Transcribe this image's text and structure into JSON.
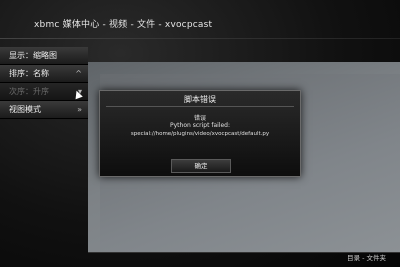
{
  "window": {
    "title": "xbmc 媒体中心 - 视频 - 文件 - xvocpcast"
  },
  "sidebar": {
    "items": [
      {
        "label": "显示：缩略图",
        "arrow": ""
      },
      {
        "label": "排序：名称",
        "arrow": "^"
      },
      {
        "label": "次序：升序",
        "arrow": "▾"
      },
      {
        "label": "视图模式",
        "arrow": "»"
      }
    ]
  },
  "dialog": {
    "title": "脚本错误",
    "subtitle": "错误",
    "message": "Python script failed:",
    "path": "special://home/plugins/video/xvocpcast/default.py",
    "ok_label": "确定"
  },
  "footer": {
    "text": "目录 - 文件夹"
  },
  "colors": {
    "panel": "#7d8286",
    "dialog_bg": "#141414",
    "accent_text": "#f0f0f0"
  }
}
